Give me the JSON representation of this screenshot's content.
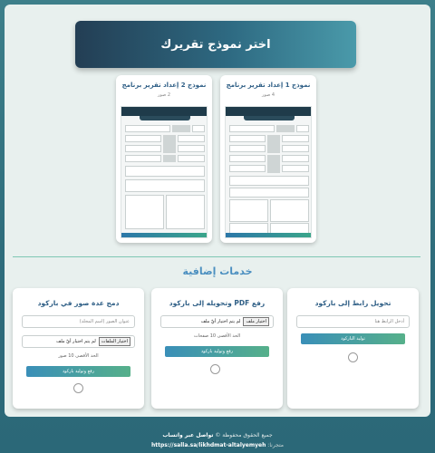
{
  "header": {
    "title": "اختر نموذج تقريرك"
  },
  "templates": [
    {
      "title": "نموذج 1 إعداد تقرير برنامج",
      "count": "4 صور"
    },
    {
      "title": "نموذج 2 إعداد تقرير برنامج",
      "count": "2 صور"
    }
  ],
  "services": {
    "title": "خدمات إضافية",
    "link_card": {
      "title": "تحويل رابط إلى باركود",
      "url_placeholder": "أدخل الرابط هنا",
      "button": "توليد الباركود"
    },
    "pdf_card": {
      "title": "رفع PDF وتحويله إلى باركود",
      "file_button": "اختيار ملف",
      "file_status": "لم يتم اختيار أيّ ملف",
      "limit": "الحد الأقصى 10 صفحات",
      "button": "رفع وتوليد باركود"
    },
    "images_card": {
      "title": "دمج عدة صور في باركود",
      "name_placeholder": "عنوان الصور (اسم المجلد)",
      "file_button": "اختيار الملفات",
      "file_status": "لم يتم اختيار أيّ ملف",
      "limit": "الحد الأقصى 10 صور",
      "button": "رفع وتوليد باركود"
    }
  },
  "footer": {
    "rights_prefix": "جميع الحقوق محفوظة ©",
    "rights_brand": "تواصل عبر واتساب",
    "store_prefix": "متجرنا:",
    "store_url": "https://salla.sa/likhdmat-altalyemyeh"
  }
}
